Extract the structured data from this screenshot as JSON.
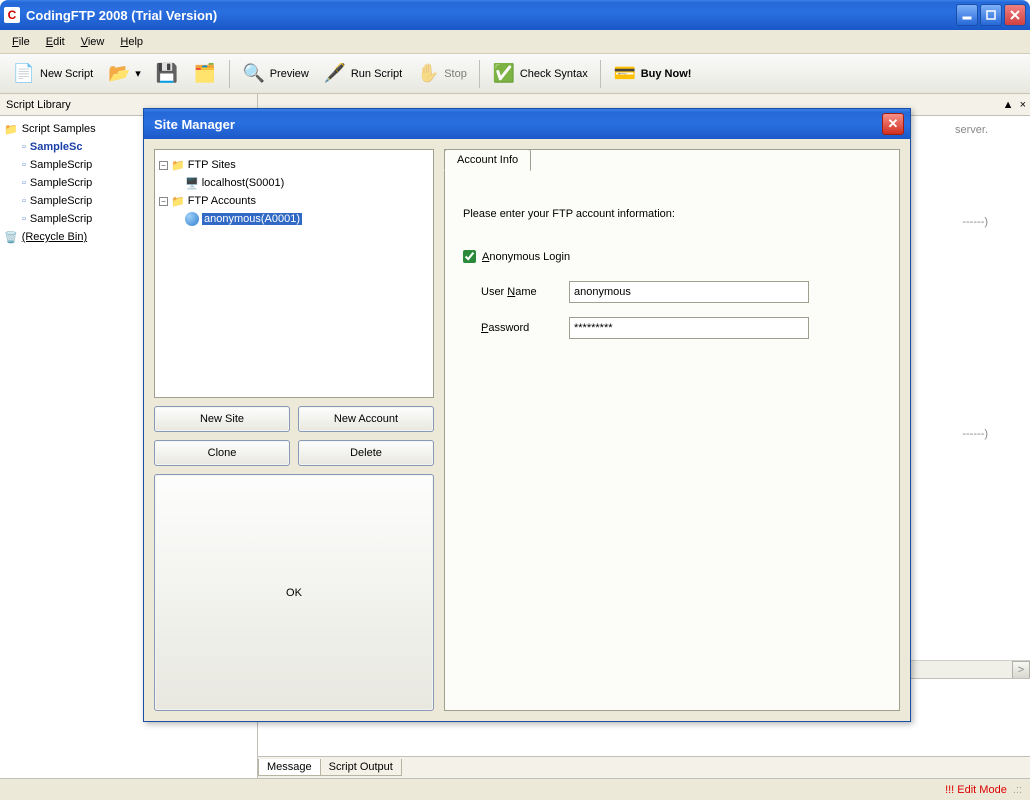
{
  "window": {
    "title": "CodingFTP 2008 (Trial Version)"
  },
  "menubar": {
    "file": "File",
    "edit": "Edit",
    "view": "View",
    "help": "Help"
  },
  "toolbar": {
    "new_script": "New Script",
    "preview": "Preview",
    "run_script": "Run Script",
    "stop": "Stop",
    "check_syntax": "Check Syntax",
    "buy_now": "Buy Now!"
  },
  "library": {
    "header": "Script Library",
    "root": "Script Samples",
    "items": [
      "SampleSc",
      "SampleScrip",
      "SampleScrip",
      "SampleScrip",
      "SampleScrip"
    ],
    "recycle": "(Recycle Bin)"
  },
  "editor": {
    "line_server": "server.",
    "dashes1": "------)",
    "dashes2": "------)",
    "scroll_right": ">"
  },
  "editor_header": {
    "caret": "▲",
    "close": "×"
  },
  "bottom_tabs": {
    "message": "Message",
    "script_output": "Script Output"
  },
  "statusbar": {
    "mode": "!!! Edit Mode",
    "grip": ".::"
  },
  "dialog": {
    "title": "Site Manager",
    "tree": {
      "ftp_sites": "FTP Sites",
      "localhost": "localhost(S0001)",
      "ftp_accounts": "FTP Accounts",
      "anonymous": "anonymous(A0001)"
    },
    "buttons": {
      "new_site": "New Site",
      "new_account": "New Account",
      "clone": "Clone",
      "delete": "Delete",
      "ok": "OK"
    },
    "tab": {
      "label": "Account Info"
    },
    "form": {
      "intro": "Please enter your FTP account information:",
      "anon_label": "Anonymous Login",
      "anon_checked": true,
      "user_label": "User Name",
      "user_value": "anonymous",
      "pass_label": "Password",
      "pass_value": "*********"
    }
  }
}
